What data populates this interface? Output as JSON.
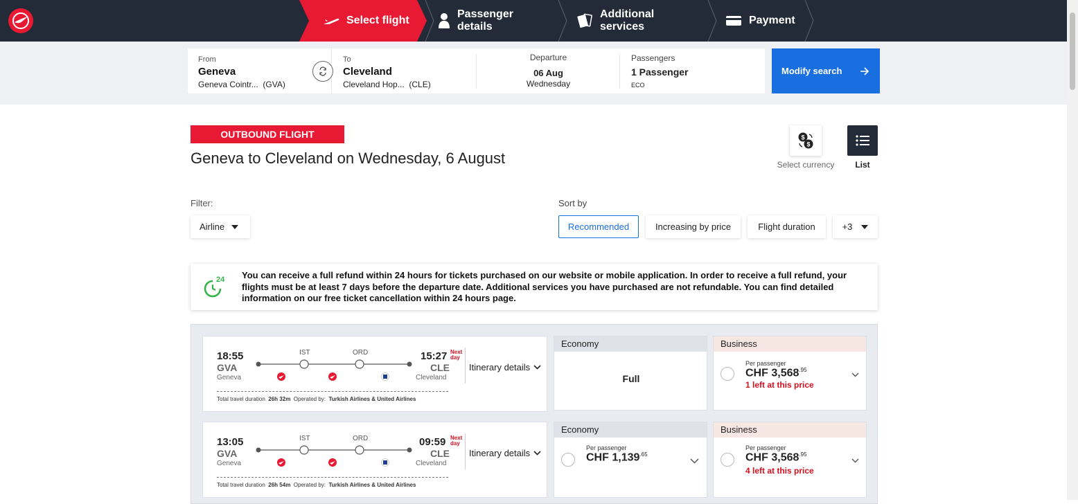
{
  "colors": {
    "brand_red": "#e81932",
    "nav_dark": "#232b38",
    "accent_blue": "#1a6fe0",
    "alert_red": "#d4101f",
    "refund_green": "#36b34a"
  },
  "steps": [
    {
      "label": "Select flight",
      "icon": "plane-takeoff-icon"
    },
    {
      "label": "Passenger details",
      "icon": "person-icon"
    },
    {
      "label": "Additional services",
      "icon": "cards-icon"
    },
    {
      "label": "Payment",
      "icon": "credit-card-icon"
    }
  ],
  "search": {
    "from_label": "From",
    "from_city": "Geneva",
    "from_airport": "Geneva Cointr...",
    "from_code": "(GVA)",
    "to_label": "To",
    "to_city": "Cleveland",
    "to_airport": "Cleveland Hop...",
    "to_code": "(CLE)",
    "dep_label": "Departure",
    "dep_date": "06 Aug",
    "dep_day": "Wednesday",
    "pax_label": "Passengers",
    "pax_value": "1 Passenger",
    "pax_class": "ECO",
    "modify_label": "Modify search"
  },
  "main": {
    "tag": "OUTBOUND FLIGHT",
    "title": "Geneva to Cleveland on Wednesday, 6 August",
    "currency_label": "Select currency",
    "list_label": "List"
  },
  "filter": {
    "label": "Filter:",
    "airline": "Airline"
  },
  "sort": {
    "label": "Sort by",
    "options": [
      "Recommended",
      "Increasing by price",
      "Flight duration",
      "+3"
    ]
  },
  "notice": {
    "badge": "24",
    "text": "You can receive a full refund within 24 hours for tickets purchased on our website or mobile application. In order to receive a full refund, your flights must be at least 7 days before the departure date. Additional services you have purchased are not refundable. You can find detailed information on our free ticket cancellation within 24 hours page."
  },
  "flights": [
    {
      "dep_time": "18:55",
      "dep_code": "GVA",
      "dep_city": "Geneva",
      "arr_time": "15:27",
      "arr_code": "CLE",
      "arr_city": "Cleveland",
      "next_day": "Next day",
      "stops": [
        "IST",
        "ORD"
      ],
      "itinerary": "Itinerary details",
      "duration_label": "Total travel duration",
      "duration": "26h 32m",
      "operated_label": "Operated by:",
      "operated": "Turkish Airlines & United Airlines",
      "economy": {
        "label": "Economy",
        "status": "Full"
      },
      "business": {
        "label": "Business",
        "per": "Per passenger",
        "currency": "CHF",
        "price": "3,568",
        "cents": ".95",
        "left": "1 left at this price"
      }
    },
    {
      "dep_time": "13:05",
      "dep_code": "GVA",
      "dep_city": "Geneva",
      "arr_time": "09:59",
      "arr_code": "CLE",
      "arr_city": "Cleveland",
      "next_day": "Next day",
      "stops": [
        "IST",
        "ORD"
      ],
      "itinerary": "Itinerary details",
      "duration_label": "Total travel duration",
      "duration": "26h 54m",
      "operated_label": "Operated by:",
      "operated": "Turkish Airlines & United Airlines",
      "economy": {
        "label": "Economy",
        "per": "Per passenger",
        "currency": "CHF",
        "price": "1,139",
        "cents": ".65"
      },
      "business": {
        "label": "Business",
        "per": "Per passenger",
        "currency": "CHF",
        "price": "3,568",
        "cents": ".95",
        "left": "4 left at this price"
      }
    }
  ]
}
